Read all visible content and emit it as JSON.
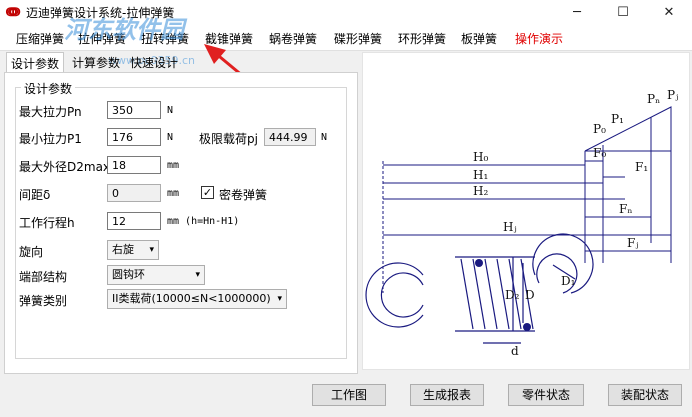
{
  "window": {
    "title": "迈迪弹簧设计系统-拉伸弹簧",
    "minimize_icon": "minimize-icon",
    "maximize_icon": "maximize-icon",
    "close_icon": "close-icon"
  },
  "watermark": {
    "text": "河东软件园",
    "url": "www.pc0359.cn"
  },
  "menu": {
    "items": [
      {
        "label": "压缩弹簧"
      },
      {
        "label": "拉伸弹簧"
      },
      {
        "label": "扭转弹簧"
      },
      {
        "label": "截锥弹簧"
      },
      {
        "label": "蜗卷弹簧"
      },
      {
        "label": "碟形弹簧"
      },
      {
        "label": "环形弹簧"
      },
      {
        "label": "板弹簧"
      },
      {
        "label": "操作演示"
      }
    ],
    "highlight_color": "#e00000"
  },
  "tabs": [
    {
      "label": "设计参数"
    },
    {
      "label": "计算参数"
    },
    {
      "label": "快速设计"
    }
  ],
  "form": {
    "group_title": "设计参数",
    "max_force": {
      "label": "最大拉力Pn",
      "value": "350",
      "unit": "N"
    },
    "min_force": {
      "label": "最小拉力P1",
      "value": "176",
      "unit": "N"
    },
    "limit_load": {
      "label": "极限载荷pj",
      "value": "444.99",
      "unit": "N"
    },
    "max_diameter": {
      "label": "最大外径D2max",
      "value": "18",
      "unit": "mm"
    },
    "gap": {
      "label": "间距δ",
      "value": "0",
      "unit": "mm"
    },
    "dense_coil": {
      "label": "密卷弹簧",
      "checked": true
    },
    "stroke": {
      "label": "工作行程h",
      "value": "12",
      "unit": "mm (h=Hn-H1)"
    },
    "direction": {
      "label": "旋向",
      "value": "右旋"
    },
    "end_structure": {
      "label": "端部结构",
      "value": "圆钩环"
    },
    "spring_class": {
      "label": "弹簧类别",
      "value": "II类载荷(10000≤N<1000000)"
    }
  },
  "diagram": {
    "labels": {
      "H0": "H₀",
      "H1": "H₁",
      "H2": "H₂",
      "Hj": "Hⱼ",
      "F0": "F₀",
      "F1": "F₁",
      "Fn": "Fₙ",
      "Fj": "Fⱼ",
      "P0": "P₀",
      "P1": "P₁",
      "Pn": "Pₙ",
      "Pj": "Pⱼ",
      "D2": "D₂",
      "D": "D",
      "D1": "D₁",
      "d": "d"
    }
  },
  "buttons": [
    {
      "label": "工作图"
    },
    {
      "label": "生成报表"
    },
    {
      "label": "零件状态"
    },
    {
      "label": "装配状态"
    }
  ]
}
